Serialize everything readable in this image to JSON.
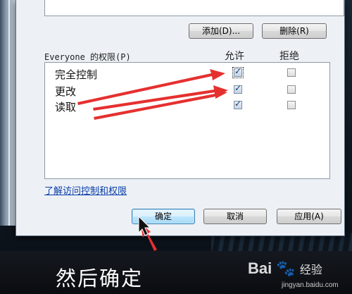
{
  "buttons": {
    "add": "添加(D)...",
    "remove": "删除(R)",
    "ok": "确定",
    "cancel": "取消",
    "apply": "应用(A)"
  },
  "permissions": {
    "header": "Everyone 的权限(P)",
    "col_allow": "允许",
    "col_deny": "拒绝",
    "rows": [
      {
        "label": "完全控制",
        "allow": true,
        "deny": false
      },
      {
        "label": "更改",
        "allow": true,
        "deny": false
      },
      {
        "label": "读取",
        "allow": true,
        "deny": false
      }
    ]
  },
  "link": "了解访问控制和权限",
  "caption": "然后确定",
  "watermark": {
    "brand": "Bai",
    "brand2": "经验",
    "url": "jingyan.baidu.com"
  },
  "colors": {
    "annotation": "#e53030",
    "link": "#0b3fa8"
  }
}
